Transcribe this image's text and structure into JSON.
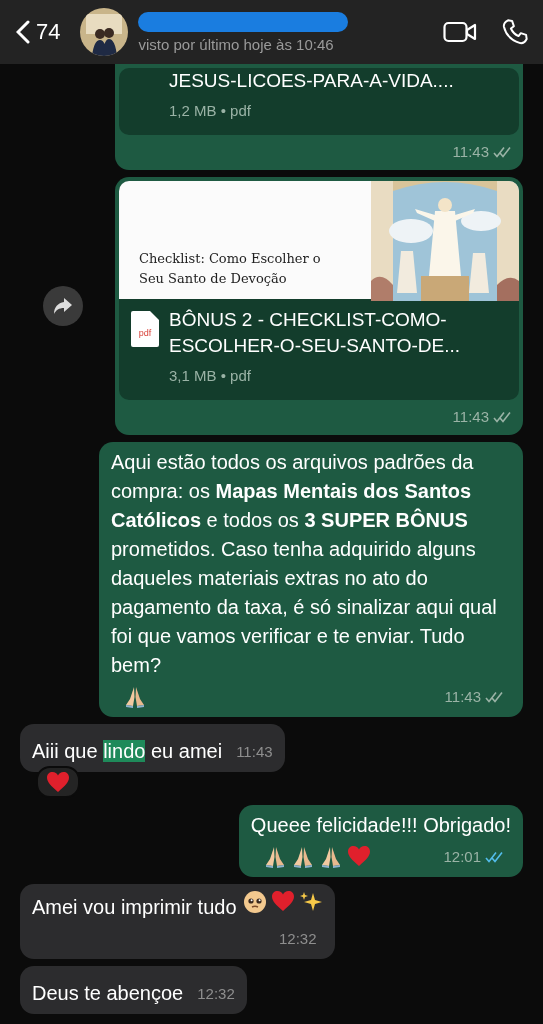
{
  "header": {
    "back_count": "74",
    "status": "visto por último hoje às 10:46"
  },
  "messages": [
    {
      "kind": "document",
      "outgoing": true,
      "partial": true,
      "file_name": "JESUS-LICOES-PARA-A-VIDA....",
      "file_info": "1,2 MB • pdf",
      "time": "11:43",
      "read": false
    },
    {
      "kind": "document",
      "outgoing": true,
      "partial": false,
      "forward": true,
      "preview_title": "Checklist: Como Escolher o Seu Santo de Devoção",
      "file_icon": "pdf",
      "file_name": "BÔNUS 2 - CHECKLIST-COMO-ESCOLHER-O-SEU-SANTO-DE...",
      "file_info": "3,1 MB • pdf",
      "time": "11:43",
      "read": false
    },
    {
      "kind": "text",
      "outgoing": true,
      "text": "Aqui estão todos os arquivos padrões da compra: os **Mapas Mentais dos Santos Católicos** e todos os **3 SUPER BÔNUS** prometidos. Caso tenha adquirido alguns daqueles materiais extras no ato do pagamento da taxa, é só sinalizar aqui qual foi que vamos verificar e te enviar. Tudo bem?",
      "emoji": [
        {
          "kind": "pray"
        }
      ],
      "time": "11:43",
      "read": false
    },
    {
      "kind": "text",
      "outgoing": false,
      "segments": [
        {
          "text": "Aiii que ",
          "highlighted": false
        },
        {
          "text": "lindo",
          "highlighted": true
        },
        {
          "text": " eu amei",
          "highlighted": false
        }
      ],
      "time": "11:43",
      "reaction": {
        "kind": "heart"
      }
    },
    {
      "kind": "text",
      "outgoing": true,
      "text": "Queee felicidade!!! Obrigado!",
      "emoji": [
        {
          "kind": "pray"
        },
        {
          "kind": "pray"
        },
        {
          "kind": "pray"
        },
        {
          "kind": "heart"
        }
      ],
      "time": "12:01",
      "read": true
    },
    {
      "kind": "text",
      "outgoing": false,
      "text": "Amei vou imprimir tudo",
      "emoji": [
        {
          "kind": "face"
        },
        {
          "kind": "heart"
        },
        {
          "kind": "sparkles"
        }
      ],
      "time": "12:32"
    },
    {
      "kind": "text",
      "outgoing": false,
      "text": "Deus te abençoe",
      "time": "12:32"
    }
  ]
}
